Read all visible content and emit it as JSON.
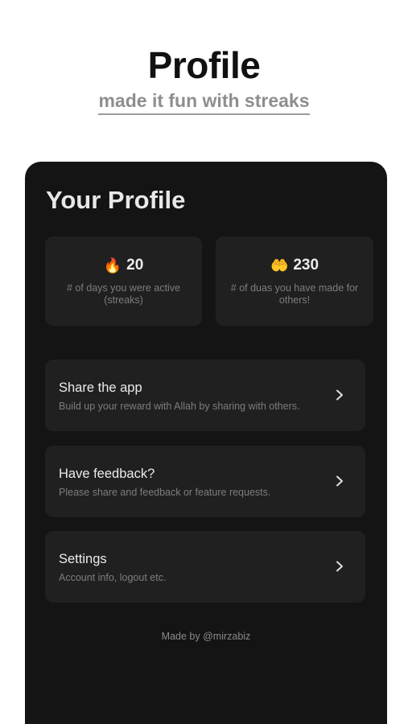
{
  "header": {
    "title": "Profile",
    "subtitle": "made it fun with streaks"
  },
  "profile": {
    "title": "Your Profile",
    "stats": [
      {
        "icon": "fire-icon",
        "emoji": "🔥",
        "value": "20",
        "description": "# of days you were active (streaks)"
      },
      {
        "icon": "praying-hands-icon",
        "emoji": "🤲",
        "value": "230",
        "description": "# of duas you have made for others!"
      }
    ],
    "items": [
      {
        "title": "Share the app",
        "description": "Build up your reward with Allah by sharing with others."
      },
      {
        "title": "Have feedback?",
        "description": "Please share and feedback or feature requests."
      },
      {
        "title": "Settings",
        "description": "Account info, logout etc."
      }
    ],
    "footer": "Made by @mirzabiz"
  },
  "colors": {
    "background": "#ffffff",
    "panel": "#141414",
    "card": "#202020",
    "text_primary": "#ececec",
    "text_secondary": "#7d7d7d"
  }
}
